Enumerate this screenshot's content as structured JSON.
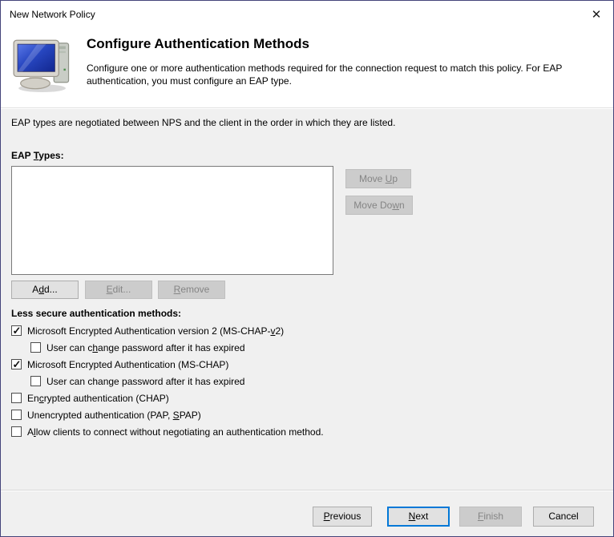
{
  "window": {
    "title": "New Network Policy",
    "close_icon_glyph": "✕"
  },
  "header": {
    "title": "Configure Authentication Methods",
    "description": "Configure one or more authentication methods required for the connection request to match this policy. For EAP authentication, you must configure an EAP type.",
    "icon": "computer-monitor-icon"
  },
  "body": {
    "intro": "EAP types are negotiated between NPS and the client in the order in which they are listed.",
    "eap_types_label": "EAP &Types:",
    "eap_list_items": [],
    "buttons": {
      "move_up": "Move &Up",
      "move_down": "Move Do&wn",
      "add": "A&dd...",
      "edit": "&Edit...",
      "remove": "&Remove"
    },
    "less_secure_heading": "Less secure authentication methods:",
    "checkboxes": [
      {
        "label": "Microsoft Encrypted Authentication version 2 (MS-CHAP-&v2)",
        "checked": true,
        "indent": false
      },
      {
        "label": "User can c&hange password after it has expired",
        "checked": false,
        "indent": true
      },
      {
        "label": "Microsoft Encrypted Authentication (MS-CHAP)",
        "checked": true,
        "indent": false
      },
      {
        "label": "User can change password after it has expired",
        "checked": false,
        "indent": true
      },
      {
        "label": "En&crypted authentication (CHAP)",
        "checked": false,
        "indent": false
      },
      {
        "label": "Unencrypted authentication (PAP, &SPAP)",
        "checked": false,
        "indent": false
      },
      {
        "label": "A&llow clients to connect without negotiating an authentication method.",
        "checked": false,
        "indent": false
      }
    ]
  },
  "footer": {
    "previous": "&Previous",
    "next": "&Next",
    "finish": "&Finish",
    "cancel": "Cancel"
  },
  "colors": {
    "accent_default_button": "#0078d7",
    "body_background": "#f0f0f0",
    "disabled_text": "#858585",
    "screen_blue": "#2746c0"
  }
}
